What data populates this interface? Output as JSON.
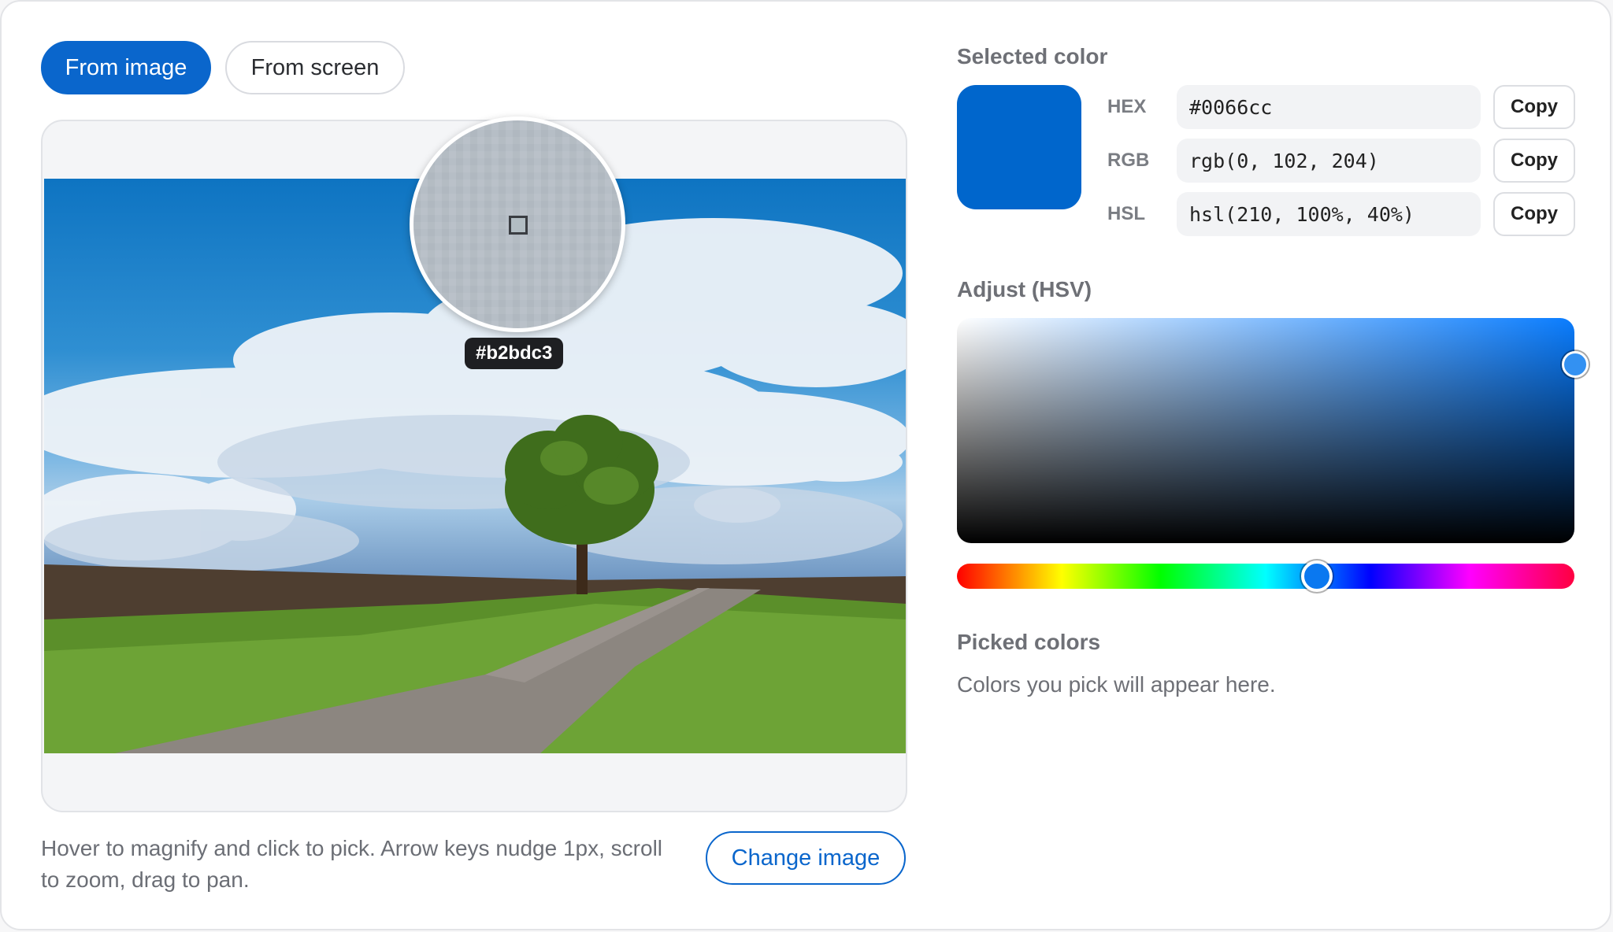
{
  "mode_tabs": {
    "from_image": "From image",
    "from_screen": "From screen"
  },
  "preview": {
    "loupe_hex": "#b2bdc3",
    "hint": "Hover to magnify and click to pick. Arrow keys nudge 1px, scroll to zoom, drag to pan.",
    "change_image": "Change image"
  },
  "selected": {
    "title": "Selected color",
    "swatch_color": "#0066cc",
    "formats": [
      {
        "label": "HEX",
        "value": "#0066cc",
        "copy": "Copy"
      },
      {
        "label": "RGB",
        "value": "rgb(0, 102, 204)",
        "copy": "Copy"
      },
      {
        "label": "HSL",
        "value": "hsl(210, 100%, 40%)",
        "copy": "Copy"
      }
    ]
  },
  "adjust": {
    "title": "Adjust (HSV)",
    "hue": 210,
    "saturation": 1.0,
    "value": 0.8
  },
  "picked": {
    "title": "Picked colors",
    "empty": "Colors you pick will appear here."
  },
  "colors": {
    "accent": "#0a66cc"
  }
}
